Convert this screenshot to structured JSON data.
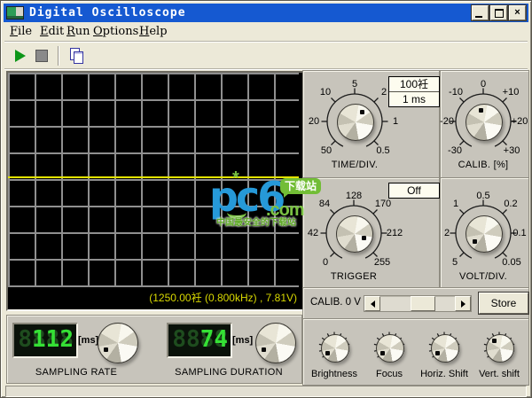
{
  "window": {
    "title": "Digital Oscilloscope",
    "close_glyph": "×"
  },
  "menu": {
    "items": [
      {
        "hot": "F",
        "rest": "ile"
      },
      {
        "hot": "E",
        "rest": "dit"
      },
      {
        "hot": "R",
        "rest": "un"
      },
      {
        "hot": "O",
        "rest": "ptions"
      },
      {
        "hot": "H",
        "rest": "elp"
      }
    ]
  },
  "scope": {
    "readout": "(1250.00衽 (0.800kHz) , 7.81V)"
  },
  "panels": {
    "time_div": {
      "caption": "TIME/DIV.",
      "scale": {
        "top": "5",
        "upper_right": "2",
        "right": "1",
        "bottom_right": "0.5",
        "bottom_left": "50",
        "left": "20",
        "upper_left": "10"
      },
      "display_line1": "100衽",
      "display_line2": "1 ms",
      "pointer": "between 5 and 2"
    },
    "calib_pct": {
      "caption": "CALIB. [%]",
      "scale": {
        "top": "0",
        "upper_right": "+10",
        "right": "+20",
        "bottom_right": "+30",
        "bottom_left": "-30",
        "left": "-20",
        "upper_left": "-10"
      },
      "pointer": "at 0"
    },
    "trigger": {
      "caption": "TRIGGER",
      "scale": {
        "top": "128",
        "upper_right": "170",
        "right": "212",
        "bottom_right": "255",
        "bottom_left": "0",
        "left": "42",
        "upper_left": "84"
      },
      "mode": "Off",
      "pointer": "between 212 and 255"
    },
    "volt_div": {
      "caption": "VOLT/DIV.",
      "scale": {
        "top": "0.5",
        "upper_right": "0.2",
        "right": "0.1",
        "bottom_right": "0.05",
        "bottom_left": "5",
        "left": "2",
        "upper_left": "1"
      },
      "pointer": "at 5"
    },
    "calib_row": {
      "label": "CALIB. 0 V",
      "store_label": "Store"
    },
    "adjust": {
      "labels": [
        "Brightness",
        "Focus",
        "Horiz. Shift",
        "Vert. shift"
      ]
    }
  },
  "sampling": {
    "rate": {
      "ghost": "8888",
      "value": "112",
      "unit": "[ms]",
      "label": "SAMPLING RATE"
    },
    "duration": {
      "ghost": "8888",
      "value": "74",
      "unit": "[ms]",
      "label": "SAMPLING DURATION"
    }
  },
  "watermark": {
    "logo": "pc6",
    "dot_com": ".com",
    "bubble": "下载站",
    "tagline": "中国最安全的下载站",
    "spark": "*"
  },
  "colors": {
    "titlebar_blue": "#1559d1",
    "panel_gray": "#c7c4bb",
    "chrome_beige": "#ece9d8",
    "led_green": "#35e035",
    "trace_yellow": "#e3e300",
    "readout_yellow": "#d9d900"
  }
}
